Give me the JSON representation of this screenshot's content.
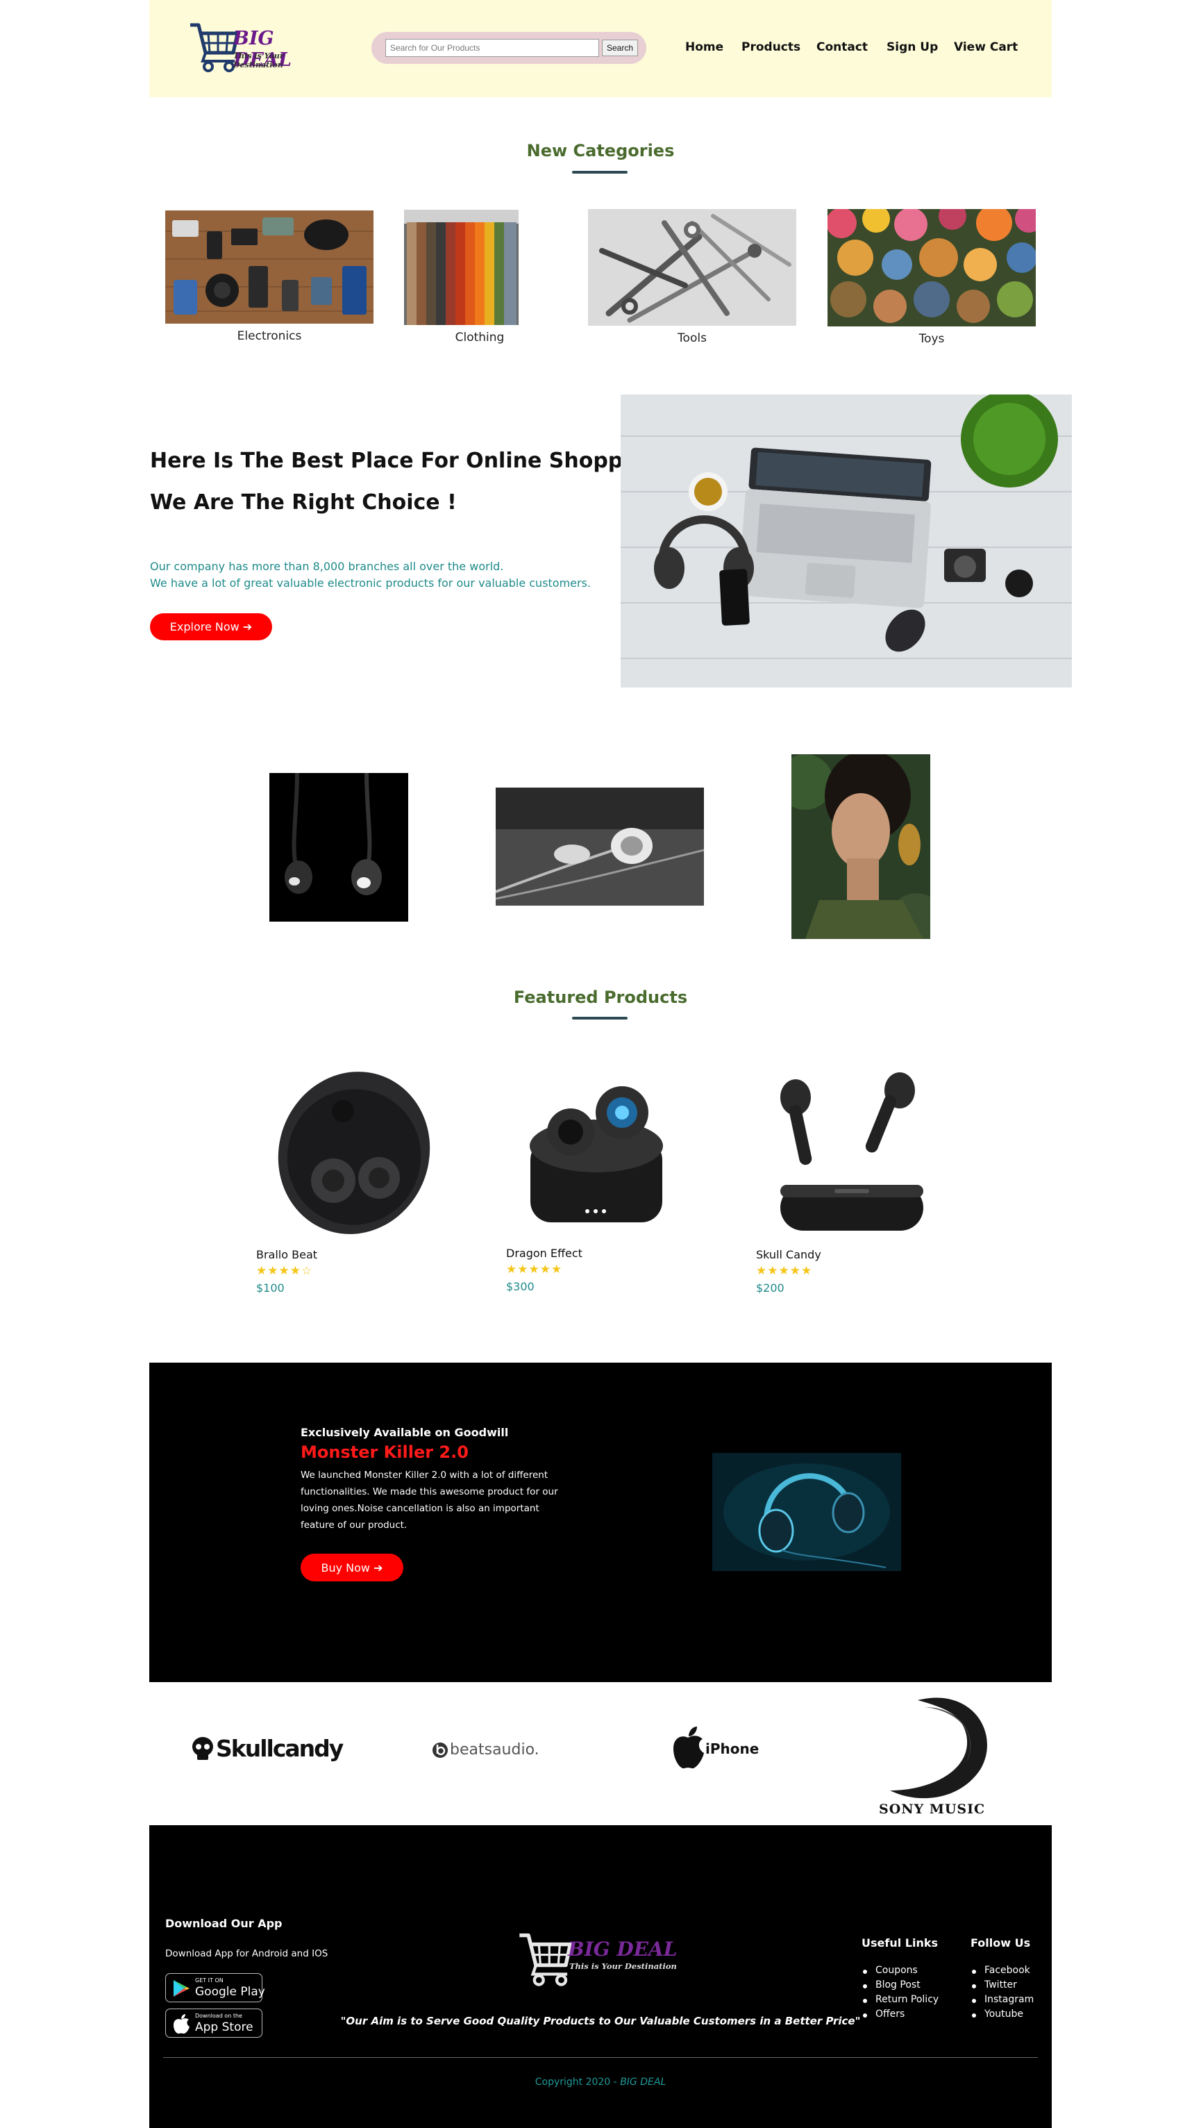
{
  "brand": {
    "name": "BIG DEAL",
    "tagline": "This is Your Destination"
  },
  "search": {
    "placeholder": "Search for Our Products",
    "button": "Search"
  },
  "nav": [
    {
      "label": "Home"
    },
    {
      "label": "Products"
    },
    {
      "label": "Contact"
    },
    {
      "label": "Sign Up"
    },
    {
      "label": "View Cart"
    }
  ],
  "categories": {
    "title": "New Categories",
    "items": [
      {
        "label": "Electronics",
        "icon": "electronics-photo"
      },
      {
        "label": "Clothing",
        "icon": "clothing-photo"
      },
      {
        "label": "Tools",
        "icon": "tools-photo"
      },
      {
        "label": "Toys",
        "icon": "toys-photo"
      }
    ]
  },
  "hero": {
    "heading_1": "Here Is The Best Place For Online Shopping",
    "heading_2": "We Are The Right Choice !",
    "text_1": "Our company has more than 8,000 branches all over the world.",
    "text_2": "We have a lot of great valuable electronic products for our valuable customers.",
    "button": "Explore Now ➔"
  },
  "featured": {
    "title": "Featured Products",
    "products": [
      {
        "name": "Brallo Beat",
        "stars": "★★★★☆",
        "rating": 4,
        "price": "$100"
      },
      {
        "name": "Dragon Effect",
        "stars": "★★★★★",
        "rating": 5,
        "price": "$300"
      },
      {
        "name": "Skull Candy",
        "stars": "★★★★★",
        "rating": 5,
        "price": "$200"
      }
    ]
  },
  "promo": {
    "eyebrow": "Exclusively Available on Goodwill",
    "title": "Monster Killer 2.0",
    "desc_1": "We launched Monster Killer 2.0 with a lot of different",
    "desc_2": "functionalities. We made this awesome product for our",
    "desc_3": "loving ones.Noise cancellation is also an important",
    "desc_4": "feature of our product.",
    "button": "Buy Now ➔"
  },
  "brands": {
    "skullcandy": "Skullcandy",
    "beats": "beatsaudio.",
    "iphone": "iPhone",
    "sony": "SONY MUSIC"
  },
  "footer": {
    "download_title": "Download Our App",
    "download_text": "Download App for Android and IOS",
    "google_small": "GET IT ON",
    "google_big": "Google Play",
    "apple_small": "Download on the",
    "apple_big": "App Store",
    "quote": "\"Our Aim is to Serve Good Quality Products to Our Valuable Customers in a Better Price\"",
    "useful_title": "Useful Links",
    "useful_links": [
      "Coupons",
      "Blog Post",
      "Return Policy",
      "Offers"
    ],
    "follow_title": "Follow Us",
    "follow_links": [
      "Facebook",
      "Twitter",
      "Instagram",
      "Youtube"
    ],
    "copyright": "Copyright 2020 - ",
    "copyright_brand": "BIG DEAL"
  },
  "colors": {
    "header_bg": "#fdfbd8",
    "accent_red": "#ff0000",
    "teal_text": "#1f8a8a",
    "section_title": "#4a6b2e",
    "brand_purple": "#6b1a8b",
    "star": "#f5c518"
  }
}
